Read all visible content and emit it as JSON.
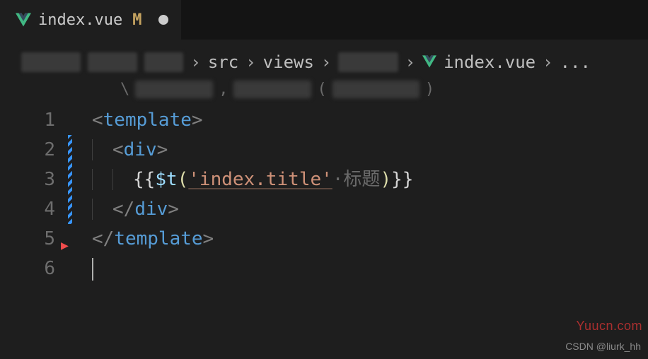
{
  "tab": {
    "filename": "index.vue",
    "modified_indicator": "M"
  },
  "breadcrumb": {
    "parts": [
      "src",
      "views",
      "index.vue"
    ],
    "trailing": "..."
  },
  "code": {
    "lines": [
      "1",
      "2",
      "3",
      "4",
      "5",
      "6"
    ],
    "tag_template": "template",
    "tag_div": "div",
    "expr_open": "{{",
    "expr_close": "}}",
    "fn_name": "$t",
    "string_arg": "'index.title'",
    "inline_hint": "·标题",
    "close_div": "div",
    "close_template": "template"
  },
  "watermark": "Yuucn.com",
  "credit": "CSDN @liurk_hh"
}
